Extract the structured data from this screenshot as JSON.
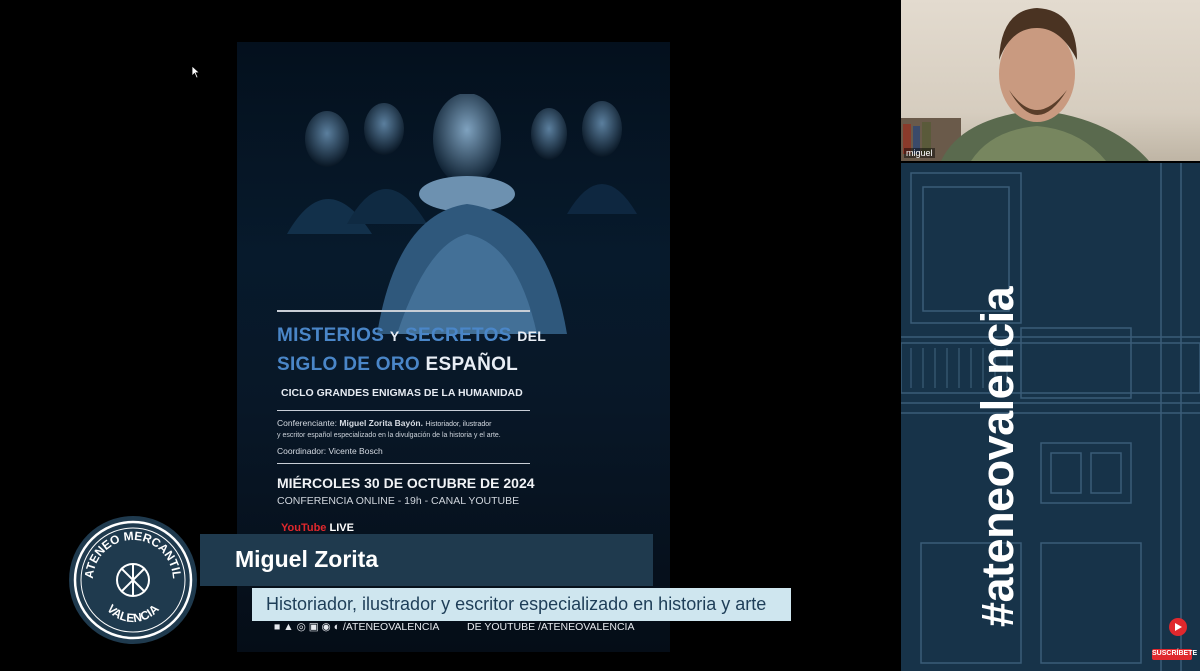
{
  "poster": {
    "title_line1_a": "MISTERIOS",
    "title_line1_b": "Y",
    "title_line1_c": "SECRETOS",
    "title_line1_d": "DEL",
    "title_line2_a": "SIGLO DE ORO",
    "title_line2_b": "ESPAÑOL",
    "cycle": "CICLO GRANDES ENIGMAS DE LA HUMANIDAD",
    "speaker_label": "Conferenciante:",
    "speaker_name": "Miguel Zorita Bayón.",
    "speaker_desc_1": "Historiador, ilustrador",
    "speaker_desc_2": "y escritor español especializado en la divulgación de la historia y el arte.",
    "coordinator": "Coordinador: Vicente Bosch",
    "date": "MIÉRCOLES 30 DE OCTUBRE DE 2024",
    "conference": "CONFERENCIA ONLINE - 19h - CANAL YOUTUBE",
    "youtube_word": "YouTube",
    "live_word": "LIVE",
    "social_handle": "/ATENEOVALENCIA",
    "youtube_channel": "DE YOUTUBE /ATENEOVALENCIA"
  },
  "lower_third": {
    "name": "Miguel Zorita",
    "description": "Historiador, ilustrador y escritor especializado en historia y arte"
  },
  "logo": {
    "top_text": "ATENEO MERCANTIL",
    "bottom_text": "VALENCIA"
  },
  "camera": {
    "participant_name": "miguel"
  },
  "brand": {
    "hashtag": "#ateneovalencia"
  },
  "subscribe": {
    "label": "SUSCRÍBETE"
  },
  "colors": {
    "accent_blue": "#4a86c8",
    "lower_third_dark": "#1f3a4e",
    "lower_third_light": "#cfe6ef",
    "brand_panel": "#173349",
    "youtube_red": "#e0282d"
  }
}
